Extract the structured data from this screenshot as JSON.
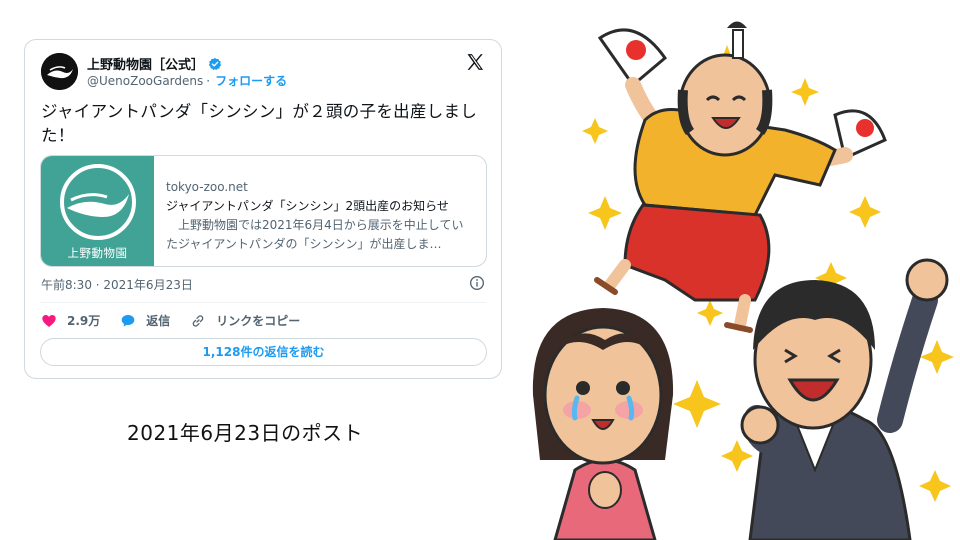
{
  "tweet": {
    "author_name": "上野動物園［公式］",
    "handle": "@UenoZooGardens",
    "separator": "·",
    "follow_label": "フォローする",
    "text": "ジャイアントパンダ「シンシン」が２頭の子を出産しました！",
    "link_card": {
      "thumbnail_label": "上野動物園",
      "domain": "tokyo-zoo.net",
      "title": "ジャイアントパンダ「シンシン」2頭出産のお知らせ",
      "description": "　上野動物園では2021年6月4日から展示を中止していたジャイアントパンダの「シンシン」が出産しま…"
    },
    "timestamp": "午前8:30 · 2021年6月23日",
    "likes": "2.9万",
    "reply_label": "返信",
    "copy_link_label": "リンクをコピー",
    "read_replies_label": "1,128件の返信を読む"
  },
  "caption": "2021年6月23日のポスト",
  "icons": {
    "avatar": "ueno-zoo-logo",
    "verified": "verified-badge-icon",
    "x": "x-logo-icon",
    "info": "info-icon",
    "like": "heart-icon",
    "reply": "speech-bubble-icon",
    "copy": "link-icon"
  },
  "colors": {
    "accent": "#1d9bf0",
    "like": "#f91880",
    "thumbnail": "#41a396",
    "muted": "#536471"
  }
}
